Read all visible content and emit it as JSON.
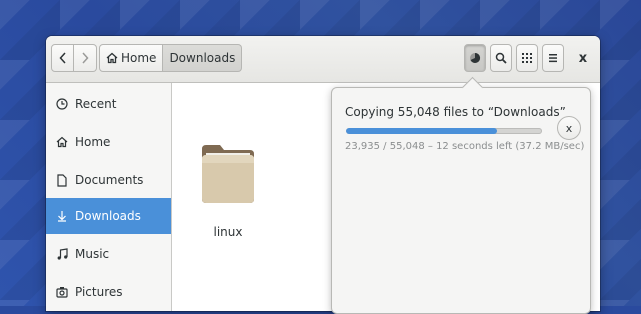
{
  "header": {
    "back_icon": "chevron-left-icon",
    "forward_icon": "chevron-right-icon",
    "breadcrumbs": [
      {
        "label": "Home",
        "icon": "home-icon"
      },
      {
        "label": "Downloads"
      }
    ],
    "operations_icon": "pie-progress-icon",
    "search_icon": "search-icon",
    "view_icon": "grid-view-icon",
    "menu_icon": "hamburger-menu-icon",
    "close_label": "x"
  },
  "sidebar": {
    "items": [
      {
        "label": "Recent",
        "icon": "clock-icon",
        "active": false
      },
      {
        "label": "Home",
        "icon": "home-icon",
        "active": false
      },
      {
        "label": "Documents",
        "icon": "document-icon",
        "active": false
      },
      {
        "label": "Downloads",
        "icon": "download-icon",
        "active": true
      },
      {
        "label": "Music",
        "icon": "music-icon",
        "active": false
      },
      {
        "label": "Pictures",
        "icon": "camera-icon",
        "active": false
      }
    ]
  },
  "files": [
    {
      "name": "linux",
      "icon": "folder-icon"
    }
  ],
  "operation": {
    "title": "Copying 55,048 files to “Downloads”",
    "status": "23,935 / 55,048 – 12 seconds left (37.2 MB/sec)",
    "progress": 0.77,
    "cancel_label": "x"
  },
  "colors": {
    "accent": "#4a90d9",
    "desktop": "#2a4a9e"
  }
}
